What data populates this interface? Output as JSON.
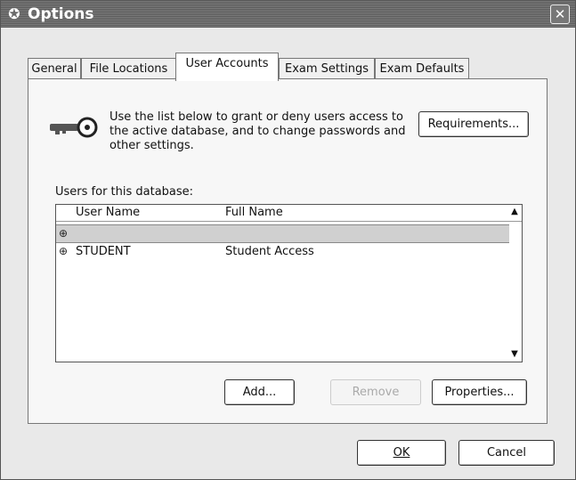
{
  "window": {
    "title": "Options",
    "close_glyph": "✕",
    "app_icon": "✪"
  },
  "tabs": [
    {
      "label": "General"
    },
    {
      "label": "File Locations"
    },
    {
      "label": "User Accounts"
    },
    {
      "label": "Exam Settings"
    },
    {
      "label": "Exam Defaults"
    }
  ],
  "active_tab": "User Accounts",
  "user_accounts": {
    "description": "Use the list below to grant or deny users access to the active database, and to change passwords and other settings.",
    "requirements_label": "Requirements...",
    "list_label": "Users for this database:",
    "columns": {
      "user_name": "User Name",
      "full_name": "Full Name"
    },
    "rows": [
      {
        "user_name": "",
        "full_name": "",
        "selected": true
      },
      {
        "user_name": "STUDENT",
        "full_name": "Student Access",
        "selected": false
      }
    ],
    "row_icon": "⊕",
    "buttons": {
      "add": "Add...",
      "remove": "Remove",
      "properties": "Properties..."
    }
  },
  "dialog_buttons": {
    "ok": "OK",
    "cancel": "Cancel"
  },
  "icons": {
    "key": "key-icon",
    "user": "user-icon"
  }
}
